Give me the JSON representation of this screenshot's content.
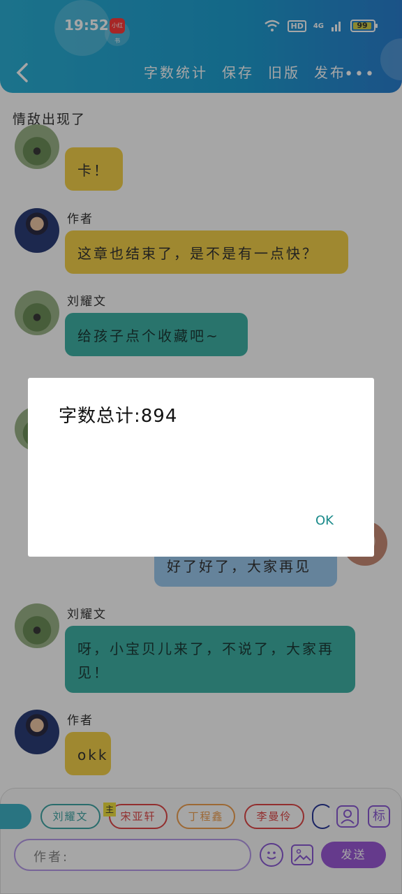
{
  "status": {
    "time": "19:52",
    "app_badge": "小红书",
    "hd": "HD",
    "net": "4G",
    "battery": "99"
  },
  "nav": {
    "back": "back",
    "actions": [
      "字数统计",
      "保存",
      "旧版",
      "发布"
    ],
    "more": "•••"
  },
  "chapter_title": "情敌出现了",
  "messages": [
    {
      "sender": "",
      "text": "卡！"
    },
    {
      "sender": "作者",
      "text": "这章也结束了，是不是有一点快？"
    },
    {
      "sender": "刘耀文",
      "text": "给孩子点个收藏吧~"
    },
    {
      "sender": "",
      "text": "好了好了，大家再见"
    },
    {
      "sender": "刘耀文",
      "text": "呀，小宝贝儿来了，不说了，大家再见！"
    },
    {
      "sender": "作者",
      "text": "okk"
    }
  ],
  "dialog": {
    "text": "字数总计:894",
    "ok": "OK"
  },
  "bottom": {
    "characters": [
      "刘耀文",
      "宋亚轩",
      "丁程鑫",
      "李曼伶"
    ],
    "host_tag": "主",
    "input_placeholder": "作者:",
    "send": "发送",
    "icon_label": "标"
  },
  "colors": {
    "header": "#1f9fd2",
    "yellow_bubble": "#f4d24a",
    "teal_bubble": "#3fb3a6",
    "blue_bubble": "#9cc9ef",
    "accent": "#9b59d8"
  }
}
